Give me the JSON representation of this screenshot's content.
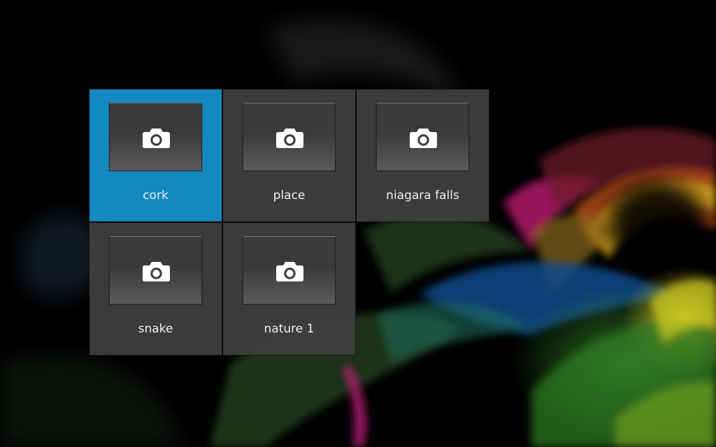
{
  "albums": [
    {
      "label": "cork",
      "icon": "camera-icon",
      "selected": true
    },
    {
      "label": "place",
      "icon": "camera-icon",
      "selected": false
    },
    {
      "label": "niagara falls",
      "icon": "camera-icon",
      "selected": false
    },
    {
      "label": "snake",
      "icon": "camera-icon",
      "selected": false
    },
    {
      "label": "nature 1",
      "icon": "camera-icon",
      "selected": false
    }
  ],
  "colors": {
    "selected_tile": "#1389bf",
    "tile": "#404040",
    "label_text": "#efefef",
    "background": "#000000"
  }
}
